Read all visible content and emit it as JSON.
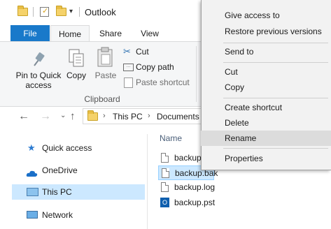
{
  "window": {
    "title": "Outlook"
  },
  "ribbon": {
    "tabs": [
      "File",
      "Home",
      "Share",
      "View"
    ],
    "buttons": {
      "pin": "Pin to Quick\naccess",
      "copy": "Copy",
      "paste": "Paste",
      "cut": "Cut",
      "copy_path": "Copy path",
      "paste_shortcut": "Paste shortcut"
    },
    "group": "Clipboard"
  },
  "nav": {
    "breadcrumb": [
      "This PC",
      "Documents"
    ]
  },
  "sidebar": {
    "items": [
      "Quick access",
      "OneDrive",
      "This PC",
      "Network"
    ]
  },
  "filelist": {
    "column_name": "Name",
    "files": [
      "backup",
      "backup.bak",
      "backup.log",
      "backup.pst"
    ]
  },
  "context_menu": {
    "items": [
      "Give access to",
      "Restore previous versions",
      "Send to",
      "Cut",
      "Copy",
      "Create shortcut",
      "Delete",
      "Rename",
      "Properties"
    ],
    "highlighted": "Rename"
  },
  "colors": {
    "accent": "#1979ca",
    "selection": "#cce8ff",
    "menu_bg": "#f2f2f2"
  }
}
